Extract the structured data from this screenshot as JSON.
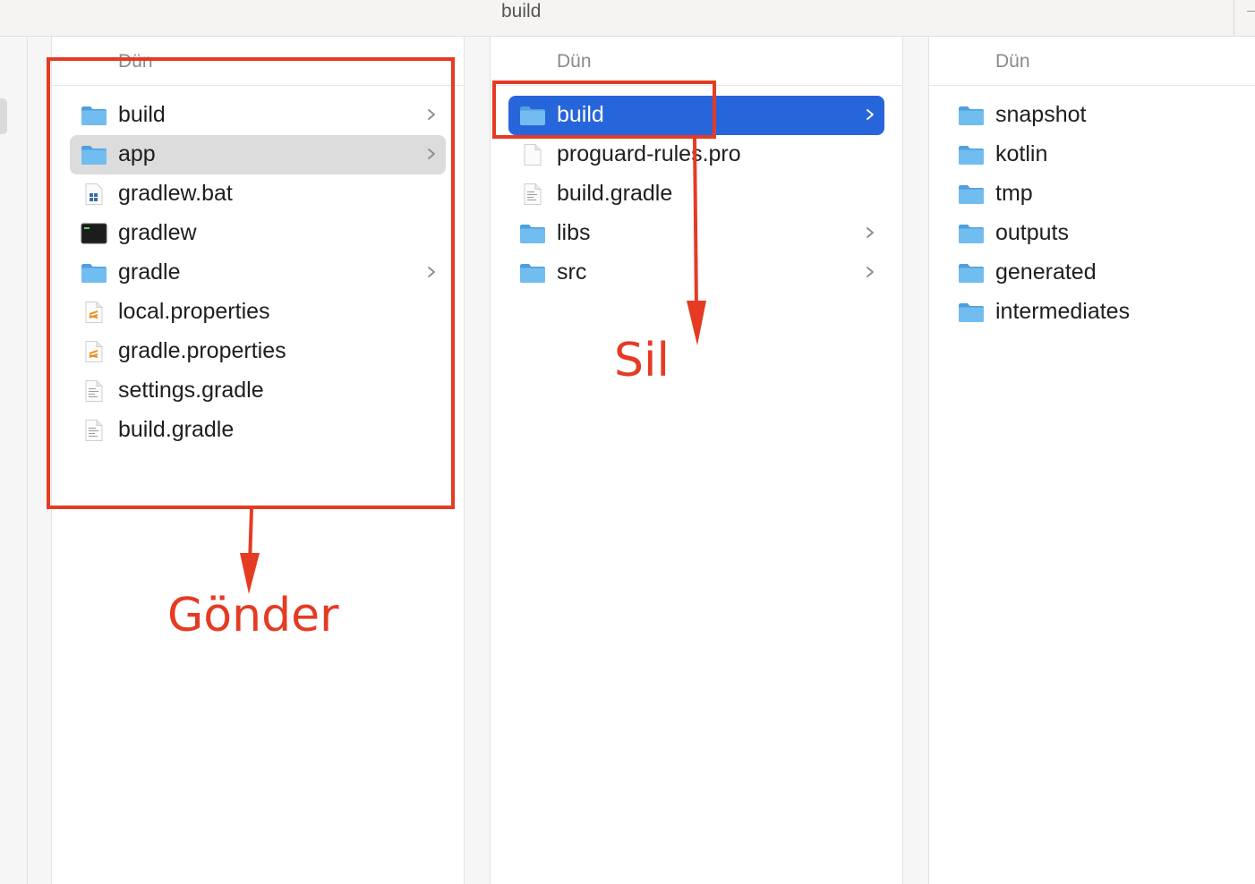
{
  "window": {
    "title": "build"
  },
  "columns": [
    {
      "header": "Dün",
      "items": [
        {
          "name": "build",
          "icon": "folder-icon",
          "chevron": true,
          "state": ""
        },
        {
          "name": "app",
          "icon": "folder-icon",
          "chevron": true,
          "state": "hover"
        },
        {
          "name": "gradlew.bat",
          "icon": "windows-batch-file-icon",
          "chevron": false,
          "state": ""
        },
        {
          "name": "gradlew",
          "icon": "terminal-exec-icon",
          "chevron": false,
          "state": ""
        },
        {
          "name": "gradle",
          "icon": "folder-icon",
          "chevron": true,
          "state": ""
        },
        {
          "name": "local.properties",
          "icon": "sublime-file-icon",
          "chevron": false,
          "state": ""
        },
        {
          "name": "gradle.properties",
          "icon": "sublime-file-icon",
          "chevron": false,
          "state": ""
        },
        {
          "name": "settings.gradle",
          "icon": "text-file-icon",
          "chevron": false,
          "state": ""
        },
        {
          "name": "build.gradle",
          "icon": "text-file-icon",
          "chevron": false,
          "state": ""
        }
      ]
    },
    {
      "header": "Dün",
      "items": [
        {
          "name": "build",
          "icon": "folder-icon",
          "chevron": true,
          "state": "selected"
        },
        {
          "name": "proguard-rules.pro",
          "icon": "blank-file-icon",
          "chevron": false,
          "state": ""
        },
        {
          "name": "build.gradle",
          "icon": "text-file-icon",
          "chevron": false,
          "state": ""
        },
        {
          "name": "libs",
          "icon": "folder-icon",
          "chevron": true,
          "state": ""
        },
        {
          "name": "src",
          "icon": "folder-icon",
          "chevron": true,
          "state": ""
        }
      ]
    },
    {
      "header": "Dün",
      "items": [
        {
          "name": "snapshot",
          "icon": "folder-icon",
          "chevron": false,
          "state": ""
        },
        {
          "name": "kotlin",
          "icon": "folder-icon",
          "chevron": false,
          "state": ""
        },
        {
          "name": "tmp",
          "icon": "folder-icon",
          "chevron": false,
          "state": ""
        },
        {
          "name": "outputs",
          "icon": "folder-icon",
          "chevron": false,
          "state": ""
        },
        {
          "name": "generated",
          "icon": "folder-icon",
          "chevron": false,
          "state": ""
        },
        {
          "name": "intermediates",
          "icon": "folder-icon",
          "chevron": false,
          "state": ""
        }
      ]
    }
  ],
  "annotations": {
    "send_label": "Gönder",
    "delete_label": "Sil",
    "color": "#e53b23"
  },
  "colors": {
    "selection": "#2765db",
    "hover": "#dcdcdc",
    "folder": "#5aaeea"
  }
}
